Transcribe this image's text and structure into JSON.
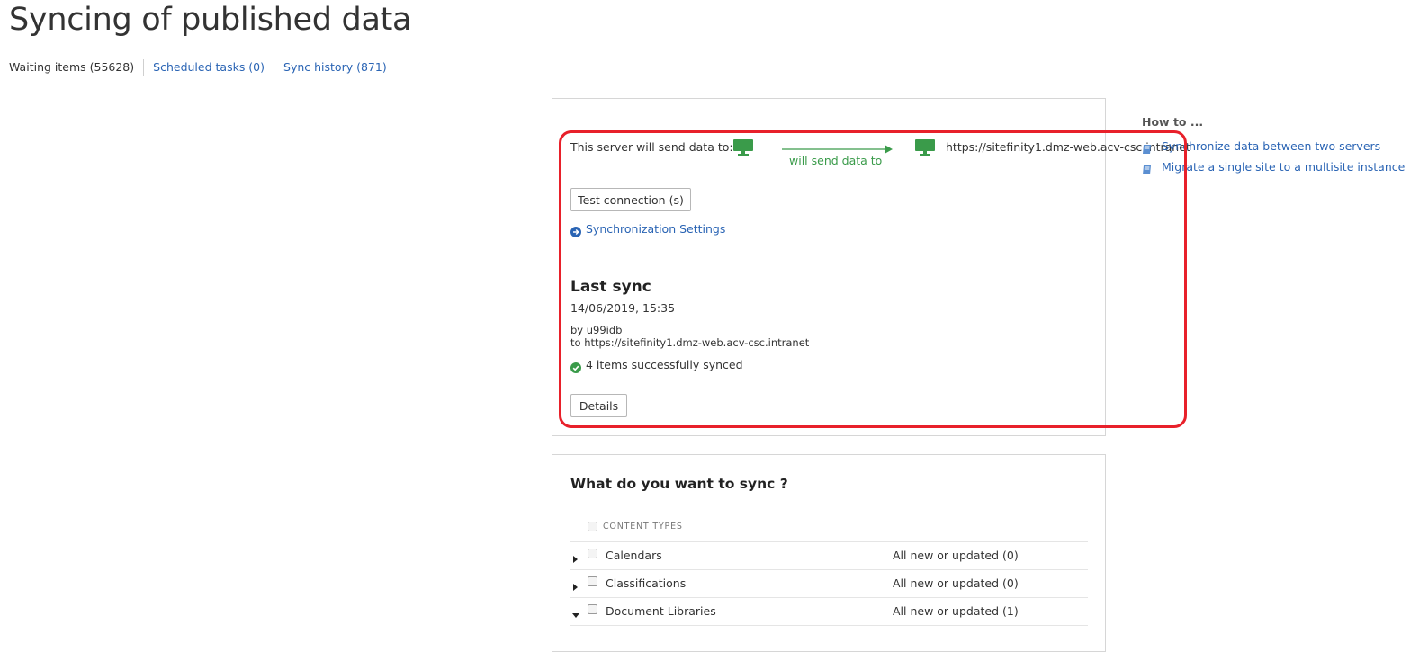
{
  "page": {
    "title": "Syncing of published data"
  },
  "tabs": [
    {
      "label": "Waiting items (55628)"
    },
    {
      "label": "Scheduled tasks (0)"
    },
    {
      "label": "Sync history (871)"
    }
  ],
  "connection": {
    "send_label": "This server will send data to:",
    "arrow_label": "will send data to",
    "target_url": "https://sitefinity1.dmz-web.acv-csc.intranet",
    "test_button": "Test connection (s)",
    "settings_link": "Synchronization Settings"
  },
  "last_sync": {
    "heading": "Last sync",
    "datetime": "14/06/2019, 15:35",
    "by": "by u99idb",
    "to": "to https://sitefinity1.dmz-web.acv-csc.intranet",
    "status": "4 items successfully synced",
    "details_button": "Details"
  },
  "how_to": {
    "title": "How to ...",
    "links": [
      {
        "label": "Synchronize data between two servers"
      },
      {
        "label": "Migrate a single site to a multisite instance"
      }
    ]
  },
  "sync_section": {
    "heading": "What do you want to sync ?",
    "content_types_header": "CONTENT TYPES",
    "rows": [
      {
        "name": "Calendars",
        "expanded": false,
        "status": "All new or updated (0)"
      },
      {
        "name": "Classifications",
        "expanded": false,
        "status": "All new or updated (0)"
      },
      {
        "name": "Document Libraries",
        "expanded": true,
        "status": "All new or updated (1)"
      }
    ]
  },
  "colors": {
    "link": "#2a64b4",
    "success": "#3a9b4a",
    "highlight": "#e8202a"
  },
  "icons": [
    "monitor-icon",
    "arrow-right-icon",
    "arrow-circle-right-icon",
    "check-circle-icon",
    "book-icon",
    "caret-right-icon",
    "caret-down-icon",
    "checkbox-icon"
  ]
}
